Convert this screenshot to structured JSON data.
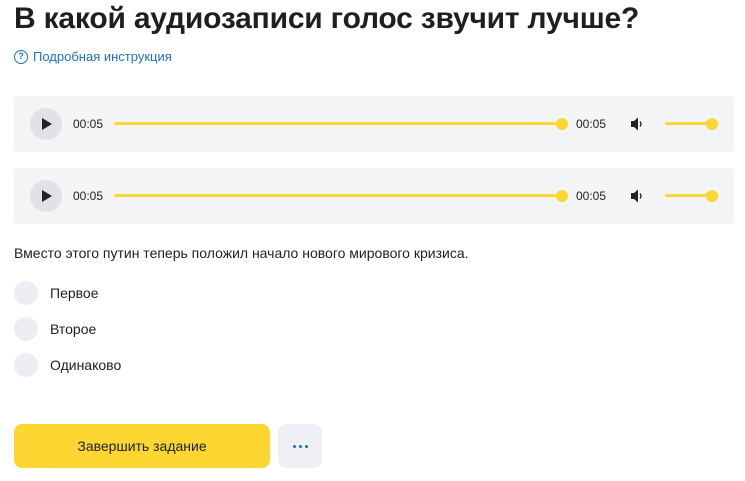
{
  "page": {
    "title": "В какой аудиозаписи голос звучит лучше?",
    "help_link": "Подробная инструкция",
    "help_icon": "question-circle-icon"
  },
  "players": [
    {
      "current_time": "00:05",
      "duration": "00:05",
      "progress": 1.0,
      "volume": 1.0
    },
    {
      "current_time": "00:05",
      "duration": "00:05",
      "progress": 1.0,
      "volume": 1.0
    }
  ],
  "question": {
    "text": "Вместо этого путин теперь положил начало нового мирового кризиса.",
    "options": [
      "Первое",
      "Второе",
      "Одинаково"
    ]
  },
  "actions": {
    "submit_label": "Завершить задание",
    "more_icon": "more-dots-icon"
  },
  "colors": {
    "accent": "#fcd732",
    "link": "#1e6fc9",
    "player_bg": "#f3f4f6",
    "radio_bg": "#eceef3"
  }
}
